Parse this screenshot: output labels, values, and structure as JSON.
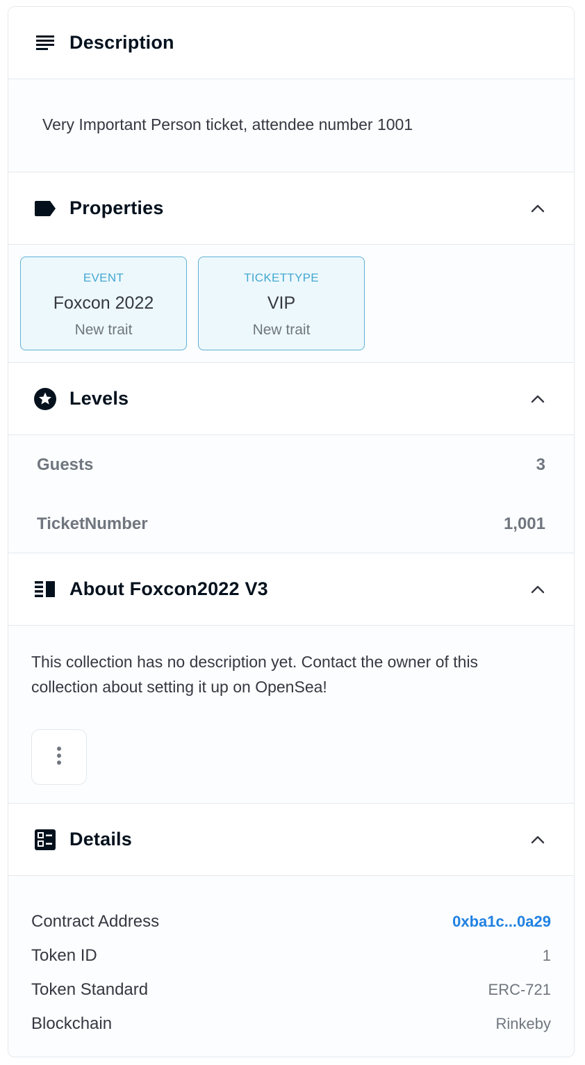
{
  "description": {
    "title": "Description",
    "text": "Very Important Person ticket, attendee number 1001"
  },
  "properties": {
    "title": "Properties",
    "traits": [
      {
        "type": "EVENT",
        "value": "Foxcon 2022",
        "rarity": "New trait"
      },
      {
        "type": "TICKETTYPE",
        "value": "VIP",
        "rarity": "New trait"
      }
    ]
  },
  "levels": {
    "title": "Levels",
    "items": [
      {
        "name": "Guests",
        "value": "3"
      },
      {
        "name": "TicketNumber",
        "value": "1,001"
      }
    ]
  },
  "about": {
    "title": "About Foxcon2022 V3",
    "text": "This collection has no description yet. Contact the owner of this collection about setting it up on OpenSea!"
  },
  "details": {
    "title": "Details",
    "rows": [
      {
        "key": "Contract Address",
        "value": "0xba1c...0a29"
      },
      {
        "key": "Token ID",
        "value": "1"
      },
      {
        "key": "Token Standard",
        "value": "ERC-721"
      },
      {
        "key": "Blockchain",
        "value": "Rinkeby"
      }
    ]
  },
  "colors": {
    "link": "#2081e2",
    "trait_border": "#5fb0d3",
    "text_primary": "#04111d",
    "text_secondary": "#70767e"
  },
  "icons": {
    "description": "subject-lines-icon",
    "properties": "label-tag-icon",
    "levels": "star-circle-icon",
    "about": "vertical-split-icon",
    "details": "ballot-icon",
    "collapse": "chevron-up-icon",
    "more": "more-vertical-icon"
  }
}
